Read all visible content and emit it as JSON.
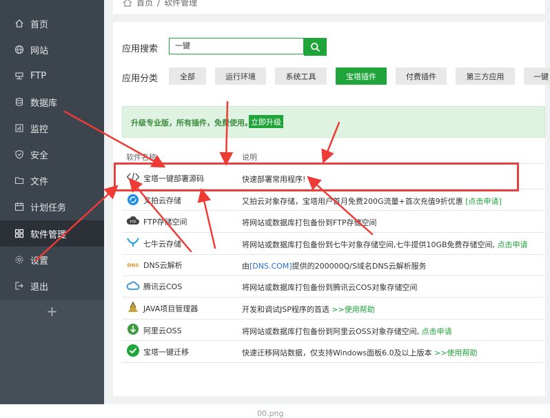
{
  "sidebar": {
    "items": [
      {
        "label": "首页",
        "icon": "home-icon"
      },
      {
        "label": "网站",
        "icon": "globe-icon"
      },
      {
        "label": "FTP",
        "icon": "ftp-icon"
      },
      {
        "label": "数据库",
        "icon": "database-icon"
      },
      {
        "label": "监控",
        "icon": "monitor-icon"
      },
      {
        "label": "安全",
        "icon": "shield-icon"
      },
      {
        "label": "文件",
        "icon": "folder-icon"
      },
      {
        "label": "计划任务",
        "icon": "calendar-icon"
      },
      {
        "label": "软件管理",
        "icon": "grid-icon",
        "active": true
      },
      {
        "label": "设置",
        "icon": "gear-icon"
      },
      {
        "label": "退出",
        "icon": "logout-icon"
      }
    ],
    "add_label": "+"
  },
  "breadcrumb": {
    "home": "首页",
    "sep": "/",
    "current": "软件管理"
  },
  "search": {
    "label": "应用搜索",
    "value": "一键"
  },
  "categories": {
    "label": "应用分类",
    "items": [
      {
        "label": "全部"
      },
      {
        "label": "运行环境"
      },
      {
        "label": "系统工具"
      },
      {
        "label": "宝塔插件",
        "active": true
      },
      {
        "label": "付费插件"
      },
      {
        "label": "第三方应用"
      },
      {
        "label": "一键"
      }
    ]
  },
  "upgrade": {
    "text": "升级专业版，所有插件，免费使用。",
    "button": "立即升级"
  },
  "table": {
    "headers": {
      "name": "软件名称",
      "desc": "说明"
    },
    "rows": [
      {
        "icon": "code-icon",
        "name": "宝塔一键部署源码",
        "desc": "快速部署常用程序!",
        "link": ""
      },
      {
        "icon": "upyun-icon",
        "name": "又拍云存储",
        "desc": "又拍云对象存储，宝塔用户首月免费200G流量+首次充值9折优惠",
        "link": "[点击申请]"
      },
      {
        "icon": "cloud-ftp-icon",
        "name": "FTP存储空间",
        "desc": "将网站或数据库打包备份到FTP存储空间",
        "link": ""
      },
      {
        "icon": "qiniu-icon",
        "name": "七牛云存储",
        "desc": "将网站或数据库打包备份到七牛对象存储空间,七牛提供10GB免费存储空间,",
        "link": "点击申请"
      },
      {
        "icon": "dns-icon",
        "name": "DNS云解析",
        "desc_pre": "由",
        "desc_blue": "[DNS.COM]",
        "desc": "提供的200000Q/S域名DNS云解析服务",
        "link": ""
      },
      {
        "icon": "tencent-cloud-icon",
        "name": "腾讯云COS",
        "desc": "将网站或数据库打包备份到腾讯云COS对象存储空间",
        "link": ""
      },
      {
        "icon": "java-icon",
        "name": "JAVA项目管理器",
        "desc": "开发和调试JSP程序的首选",
        "link": ">>使用帮助"
      },
      {
        "icon": "aliyun-oss-icon",
        "name": "阿里云OSS",
        "desc": "将网站或数据库打包备份到阿里云OSS对象存储空间,",
        "link": "点击申请"
      },
      {
        "icon": "check-circle-icon",
        "name": "宝塔一键迁移",
        "desc": "快速迁移网站数据，仅支持Windows面板6.0及以上版本",
        "link": ">>使用帮助"
      }
    ]
  },
  "caption": "00.png",
  "colors": {
    "accent": "#20a53a",
    "sidebar": "#3c444d",
    "highlight": "#e8403f"
  }
}
